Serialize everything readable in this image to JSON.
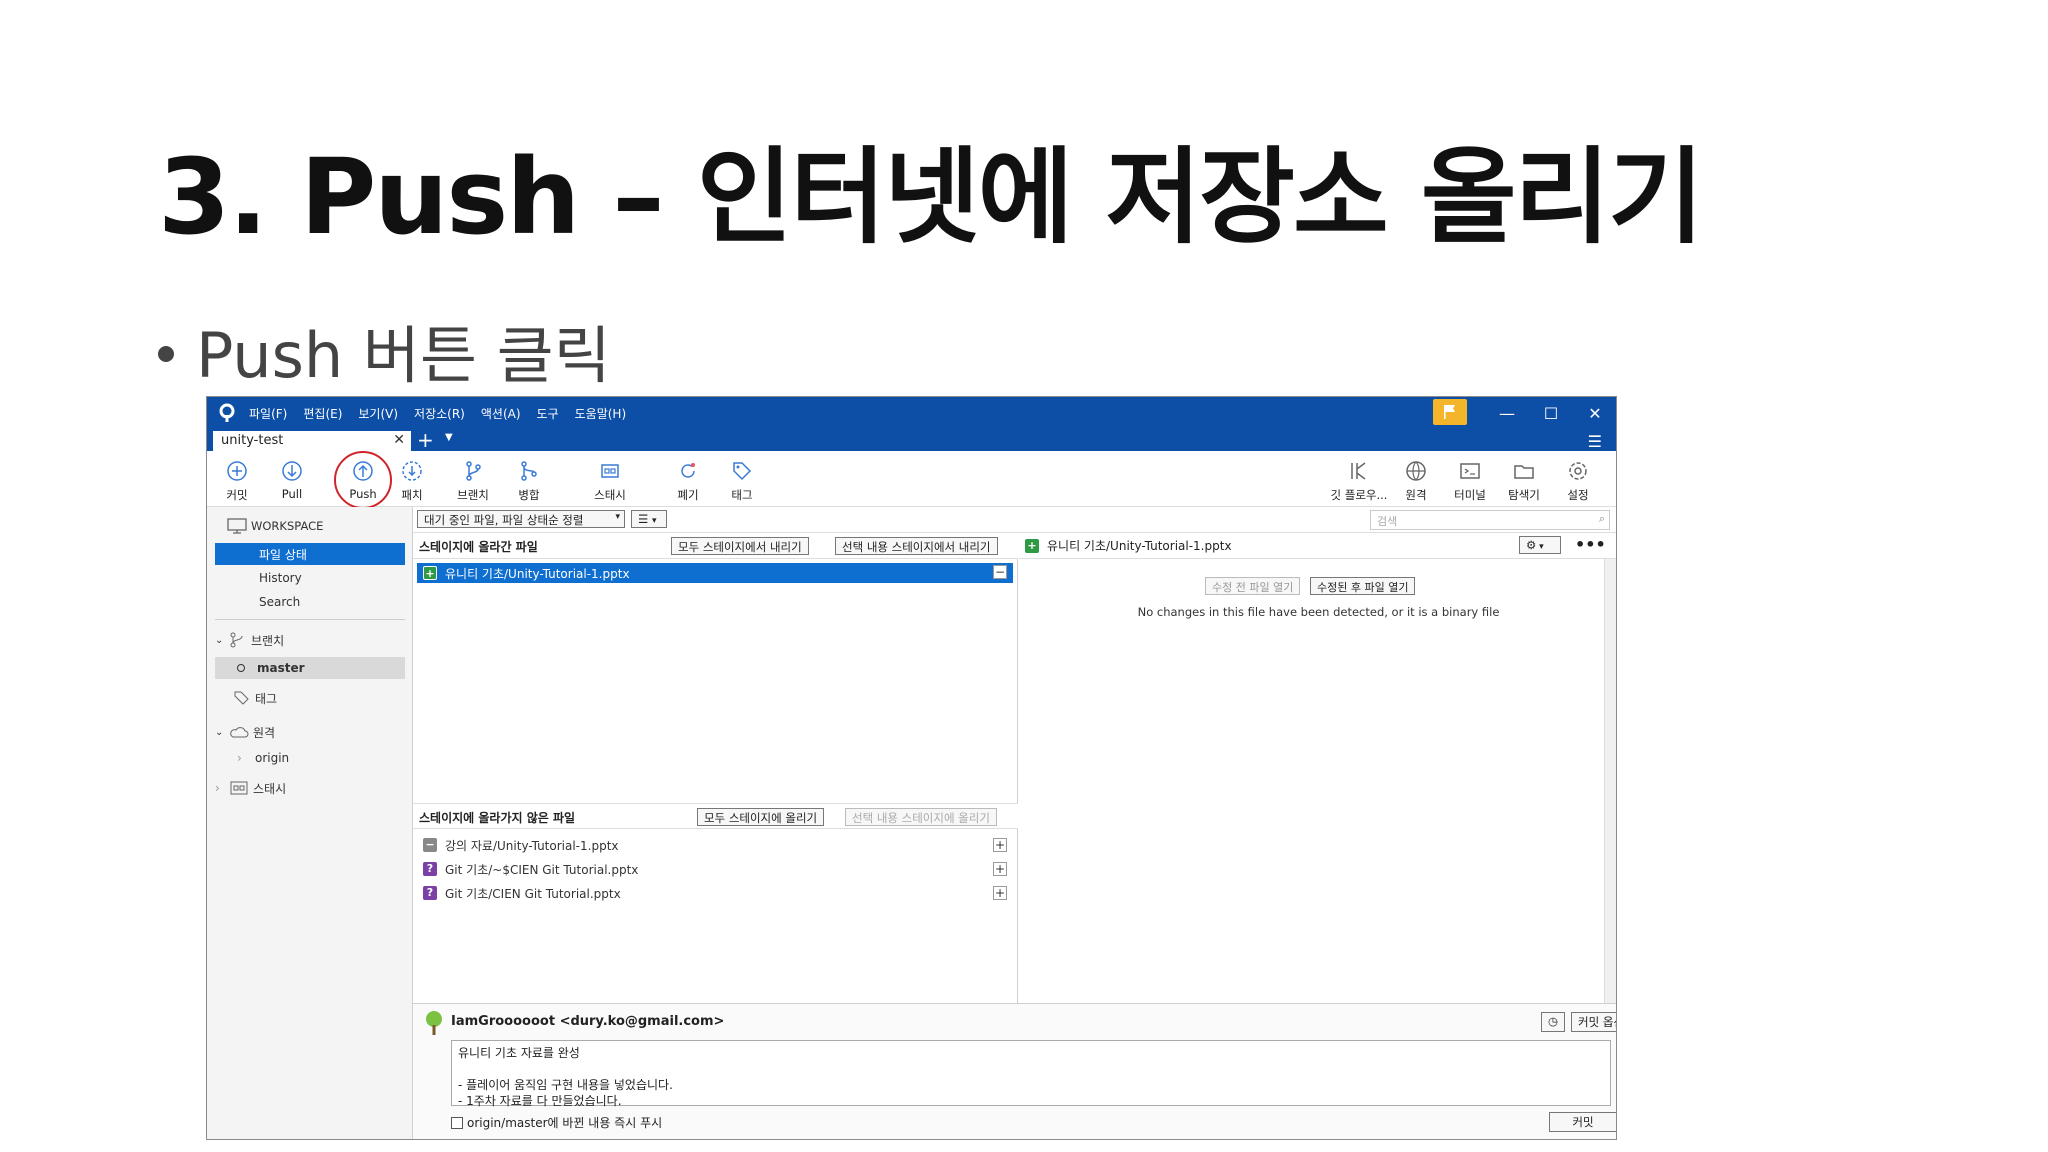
{
  "slide": {
    "title": "3. Push – 인터넷에 저장소 올리기",
    "bullet": "Push 버튼 클릭"
  },
  "app": {
    "menu": [
      "파일(F)",
      "편집(E)",
      "보기(V)",
      "저장소(R)",
      "액션(A)",
      "도구",
      "도움말(H)"
    ],
    "tab": {
      "label": "unity-test"
    },
    "toolbar": {
      "commit": "커밋",
      "pull": "Pull",
      "push": "Push",
      "fetch": "패치",
      "branch": "브랜치",
      "merge": "병합",
      "stash": "스태시",
      "discard": "폐기",
      "tag": "태그",
      "git_flow": "깃 플로우...",
      "remote": "원격",
      "terminal": "터미널",
      "explorer": "탐색기",
      "settings": "설정"
    },
    "sidebar": {
      "workspace": "WORKSPACE",
      "file_status": "파일 상태",
      "history": "History",
      "search": "Search",
      "branches": "브랜치",
      "master": "master",
      "tags": "태그",
      "remotes": "원격",
      "origin": "origin",
      "stashes": "스태시"
    },
    "filebar": {
      "sort": "대기 중인 파일, 파일 상태순 정렬",
      "search_placeholder": "검색"
    },
    "staged": {
      "header": "스테이지에 올라간 파일",
      "unstage_all": "모두 스테이지에서 내리기",
      "unstage_selected": "선택 내용 스테이지에서 내리기",
      "files": [
        "유니티 기초/Unity-Tutorial-1.pptx"
      ]
    },
    "unstaged": {
      "header": "스테이지에 올라가지 않은 파일",
      "stage_all": "모두 스테이지에 올리기",
      "stage_selected": "선택 내용 스테이지에 올리기",
      "files": [
        "강의 자료/Unity-Tutorial-1.pptx",
        "Git 기초/~$CIEN Git Tutorial.pptx",
        "Git 기초/CIEN Git Tutorial.pptx"
      ]
    },
    "diff": {
      "file": "유니티 기초/Unity-Tutorial-1.pptx",
      "open_before": "수정 전 파일 열기",
      "open_after": "수정된 후 파일 열기",
      "message": "No changes in this file have been detected, or it is a binary file"
    },
    "commit": {
      "author": "IamGroooooot <dury.ko@gmail.com>",
      "options": "커밋 옵션...",
      "message": "유니티 기초 자료를 완성\n\n- 플레이어 움직임 구현 내용을 넣었습니다.\n- 1주차 자료를 다 만들었습니다.",
      "push_checkbox": "origin/master에 바뀐 내용 즉시 푸시",
      "commit_button": "커밋"
    },
    "colors": {
      "titlebar": "#0d4ea6",
      "selection": "#0f6fd1",
      "highlight_circle": "#d0242b"
    }
  }
}
